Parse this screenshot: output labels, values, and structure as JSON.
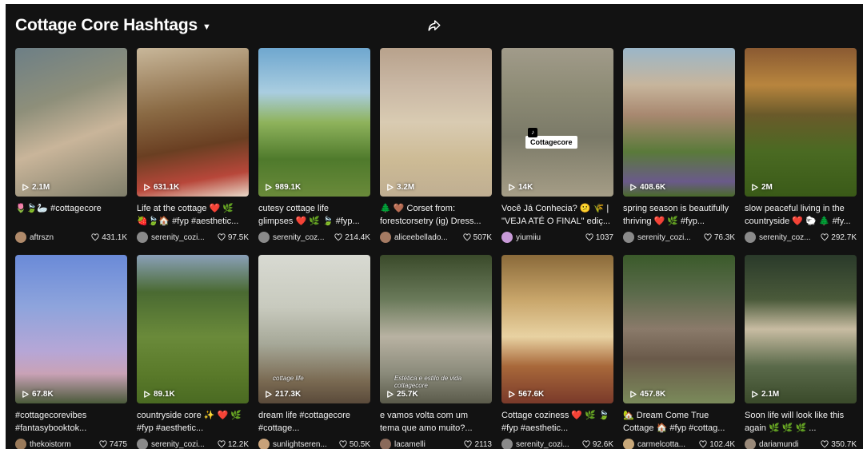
{
  "header": {
    "title": "Cottage Core Hashtags",
    "dropdown_icon": "caret-down-icon",
    "share_icon": "share-icon"
  },
  "videos": [
    {
      "views": "2.1M",
      "caption1": "🌷🍃🦢 #cottagecore",
      "caption2": "",
      "author": "aftrszn",
      "likes": "431.1K",
      "bg": "linear-gradient(160deg,#6d7f86 0%,#8e8f7a 35%,#c9b59a 60%,#7f7e6a 100%)",
      "avatar": "#b08a6a"
    },
    {
      "views": "631.1K",
      "caption1": "Life at the cottage ❤️ 🌿",
      "caption2": "🍓🍃🏠 #fyp #aesthetic...",
      "author": "serenity_cozi...",
      "likes": "97.5K",
      "bg": "linear-gradient(170deg,#c8b79a 0%,#8a6a44 40%,#6a3f22 65%,#b8473a 85%,#e8d8c8 100%)",
      "avatar": "#8a8a8a"
    },
    {
      "views": "989.1K",
      "caption1": "cutesy cottage life",
      "caption2": "glimpses ❤️ 🌿 🍃 #fyp...",
      "author": "serenity_coz...",
      "likes": "214.4K",
      "bg": "linear-gradient(180deg,#6fa7cf 0%,#a9cde0 30%,#8fb35c 50%,#4f7a2c 75%,#6a8a3a 100%)",
      "avatar": "#8a8a8a"
    },
    {
      "views": "3.2M",
      "caption1": "🌲 🤎 Corset from:",
      "caption2": "forestcorsetry (ig) Dress...",
      "author": "aliceebellado...",
      "likes": "507K",
      "bg": "linear-gradient(180deg,#b8a28c 0%,#c9b7a4 25%,#d9cbb2 50%,#cdbb95 75%,#bfae92 100%)",
      "avatar": "#a57b63"
    },
    {
      "views": "14K",
      "caption1": "Você Já Conhecia? 😕 🌾 |",
      "caption2": "\"VEJA ATÉ O FINAL\" ediç...",
      "author": "yiumiiu",
      "likes": "1037",
      "bg": "linear-gradient(180deg,#a19b8a 0%,#8d8b75 30%,#7b7a68 60%,#a59d86 100%)",
      "avatar": "#c89ad8",
      "tag": "Cottagecore"
    },
    {
      "views": "408.6K",
      "caption1": "spring season is beautifully",
      "caption2": "thriving ❤️ 🌿 #fyp...",
      "author": "serenity_cozi...",
      "likes": "76.3K",
      "bg": "linear-gradient(180deg,#9bb6c8 0%,#c7b59c 25%,#a88870 45%,#5a7a3a 70%,#6a5a8a 90%,#4a6a2a 100%)",
      "avatar": "#8a8a8a"
    },
    {
      "views": "2M",
      "caption1": "slow peaceful living in the",
      "caption2": "countryside ❤️ 🐑 🌲 #fy...",
      "author": "serenity_coz...",
      "likes": "292.7K",
      "bg": "linear-gradient(180deg,#8a5a32 0%,#b8853e 25%,#6a5a2a 45%,#4a6a22 70%,#3a5a18 100%)",
      "avatar": "#8a8a8a"
    },
    {
      "views": "67.8K",
      "caption1": "#cottagecorevibes",
      "caption2": "#fantasybooktok...",
      "author": "thekoistorm",
      "likes": "7475",
      "bg": "linear-gradient(180deg,#6a8ad8 0%,#8ea4dc 35%,#b6a6d6 65%,#c9a2b6 80%,#4a5a3a 100%)",
      "avatar": "#9a7a5a"
    },
    {
      "views": "89.1K",
      "caption1": "countryside core ✨ ❤️ 🌿",
      "caption2": "#fyp #aesthetic...",
      "author": "serenity_cozi...",
      "likes": "12.2K",
      "bg": "linear-gradient(180deg,#8aa0b8 0%,#4a6a32 25%,#6a8a3a 55%,#5a7a2a 80%,#4a6a22 100%)",
      "avatar": "#8a8a8a"
    },
    {
      "views": "217.3K",
      "caption1": "dream life #cottagecore",
      "caption2": "#cottage...",
      "author": "sunlightseren...",
      "likes": "50.5K",
      "bg": "linear-gradient(180deg,#d8dad2 0%,#c8cabe 35%,#a6a898 60%,#7a6a52 85%,#5a4a3a 100%)",
      "avatar": "#c8a27a",
      "overlay": "cottage life"
    },
    {
      "views": "25.7K",
      "caption1": "e vamos volta com um",
      "caption2": "tema que amo muito?...",
      "author": "lacamelli",
      "likes": "2113",
      "bg": "linear-gradient(180deg,#3a4a2a 0%,#6a7a5a 30%,#b8b2a2 55%,#8a8a7a 80%,#5a5a4a 100%)",
      "avatar": "#8a6a5a",
      "overlay": "Estética e estilo de vida cottagecore"
    },
    {
      "views": "567.6K",
      "caption1": "Cottage coziness ❤️ 🌿 🍃",
      "caption2": "#fyp #aesthetic...",
      "author": "serenity_cozi...",
      "likes": "92.6K",
      "bg": "linear-gradient(180deg,#8a6a3a 0%,#c8a56a 30%,#e8d2a2 55%,#a8683a 75%,#7a3a2a 100%)",
      "avatar": "#8a8a8a"
    },
    {
      "views": "457.8K",
      "caption1": "🏡 Dream Come True",
      "caption2": "Cottage 🏠 #fyp #cottag...",
      "author": "carmelcotta...",
      "likes": "102.4K",
      "bg": "linear-gradient(180deg,#3a5a2a 0%,#5a6a4a 25%,#8a7a6a 50%,#6a5a4a 70%,#7a8a5a 100%)",
      "avatar": "#c8a87a"
    },
    {
      "views": "2.1M",
      "caption1": "Soon life will look like this",
      "caption2": "again 🌿 🌿 🌿 ...",
      "author": "dariamundi",
      "likes": "350.7K",
      "bg": "linear-gradient(180deg,#2a3a2a 0%,#4a5a3a 30%,#c8bca2 50%,#5a6a4a 75%,#3a4a2a 100%)",
      "avatar": "#9a8a7a"
    }
  ]
}
